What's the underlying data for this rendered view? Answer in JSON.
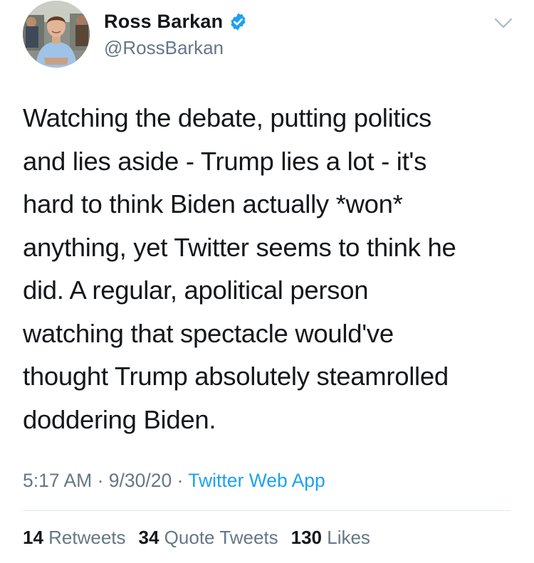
{
  "author": {
    "display_name": "Ross Barkan",
    "handle": "@RossBarkan",
    "verified": true
  },
  "tweet": {
    "text": "Watching the debate, putting politics\nand lies aside - Trump lies a lot - it's\nhard to think Biden actually *won*\nanything, yet Twitter seems to think he\ndid. A regular, apolitical person\nwatching that spectacle would've\nthought Trump absolutely steamrolled\ndoddering Biden."
  },
  "meta": {
    "time": "5:17 AM",
    "separator": " · ",
    "date": "9/30/20",
    "source": "Twitter Web App"
  },
  "stats": {
    "retweets_count": "14",
    "retweets_label": " Retweets",
    "quotes_count": "34",
    "quotes_label": " Quote Tweets",
    "likes_count": "130",
    "likes_label": " Likes"
  },
  "icons": {
    "verified": "verified-badge-icon",
    "menu": "chevron-down-icon"
  },
  "colors": {
    "accent": "#1da1f2",
    "secondary_text": "#657786",
    "primary_text": "#14171a",
    "divider": "#e1e8ed"
  }
}
